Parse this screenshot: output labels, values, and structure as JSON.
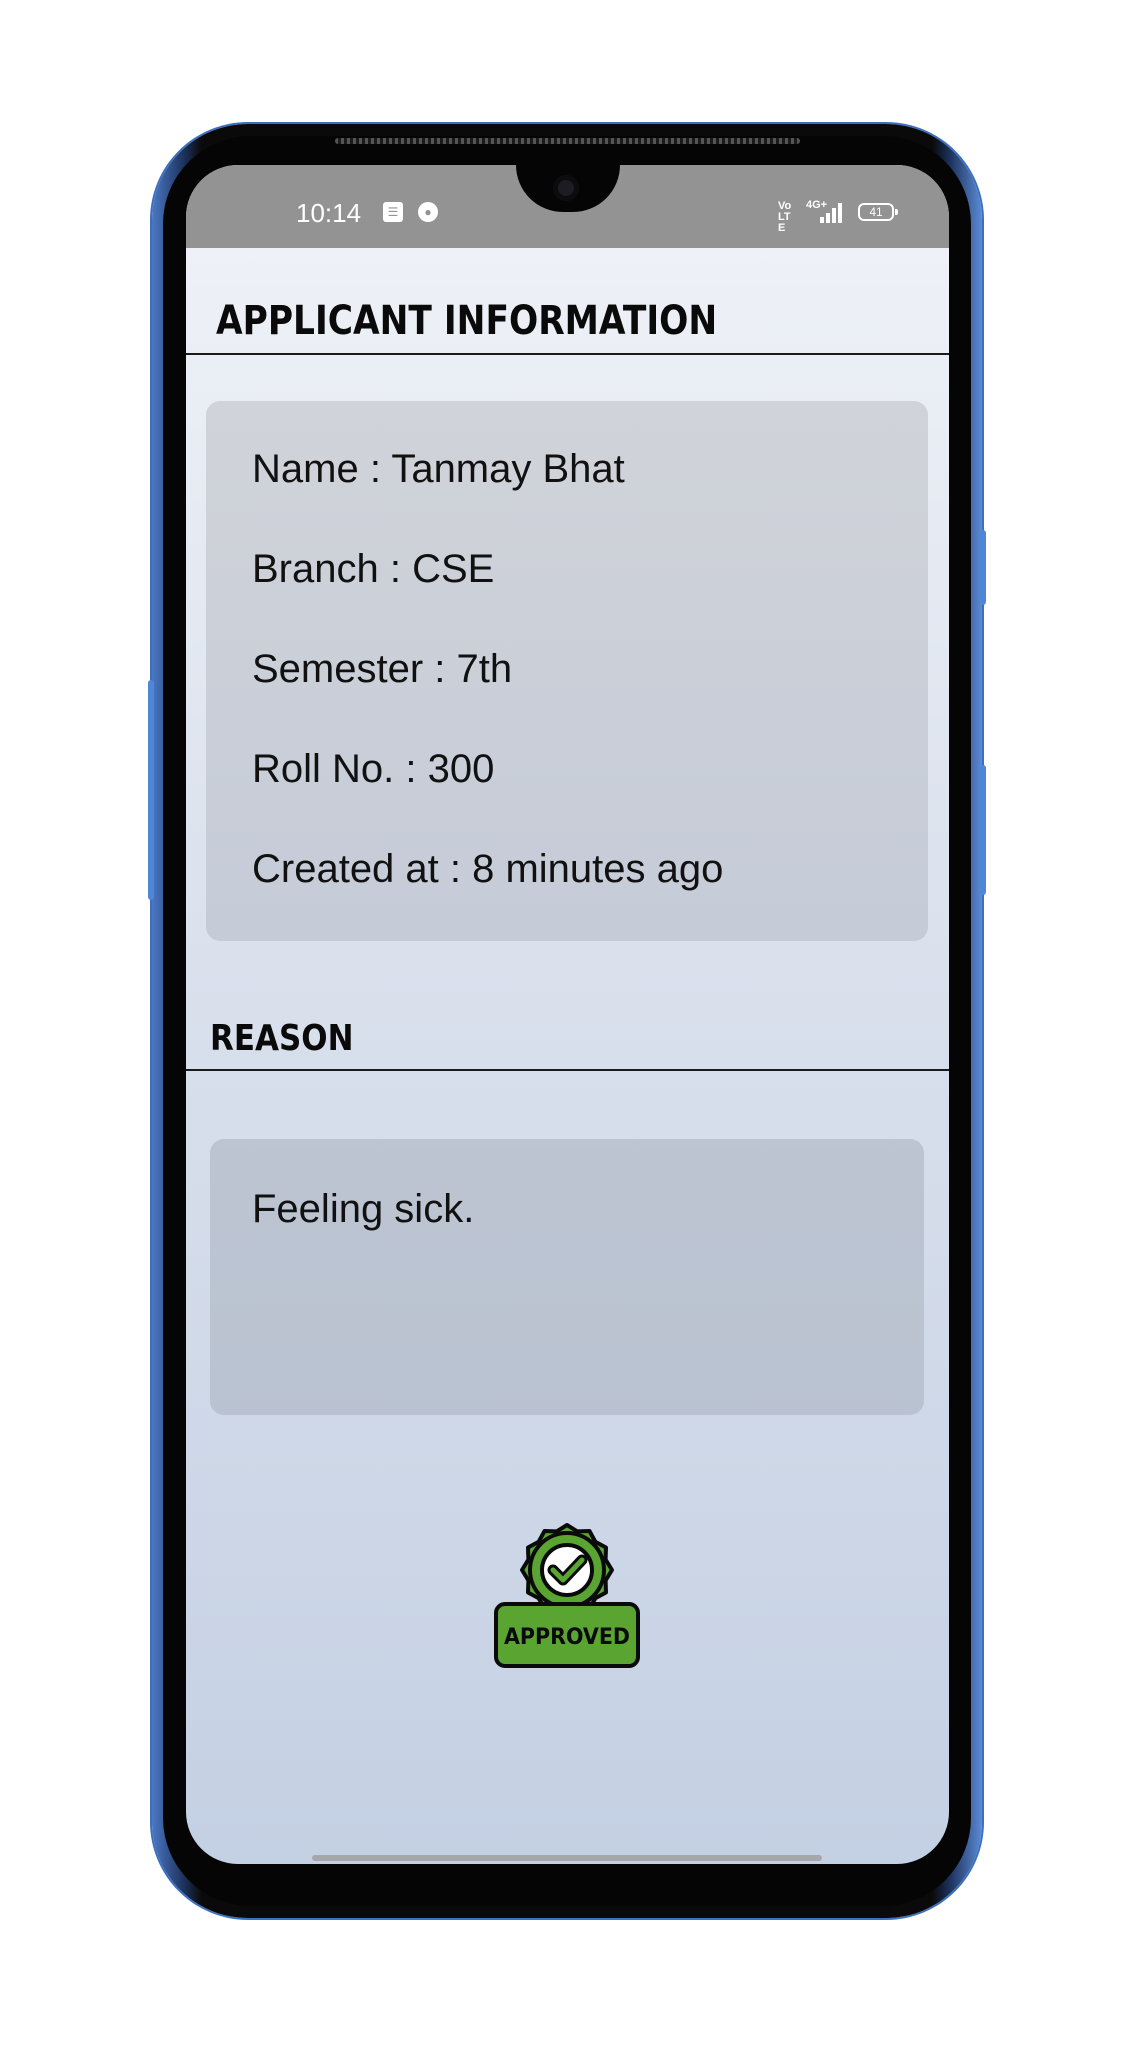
{
  "status_bar": {
    "time": "10:14",
    "network_label": "4G+",
    "volte_label": "Vo LTE",
    "battery": "41"
  },
  "applicant": {
    "section_title": "APPLICANT INFORMATION",
    "fields": [
      "Name : Tanmay Bhat",
      "Branch : CSE",
      "Semester : 7th",
      "Roll No. : 300",
      "Created at : 8 minutes ago"
    ]
  },
  "reason": {
    "section_title": "REASON",
    "text": "Feeling sick."
  },
  "status_badge": {
    "label": "APPROVED",
    "color": "#5aa531"
  }
}
